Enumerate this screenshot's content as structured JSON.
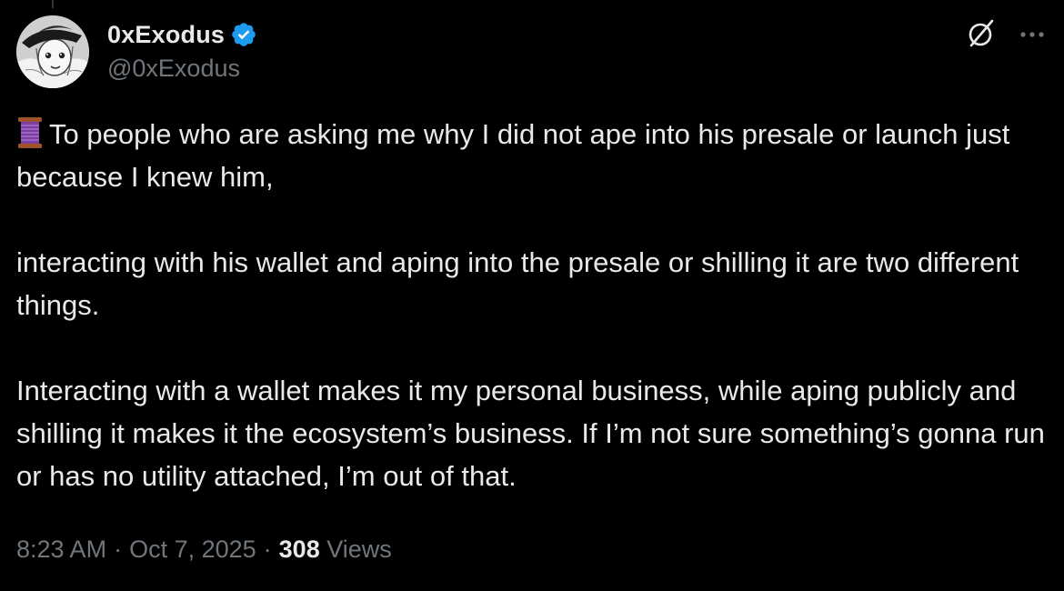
{
  "author": {
    "display_name": "0xExodus",
    "handle": "@0xExodus",
    "verified": true
  },
  "icons": {
    "verified": "verified-badge-icon",
    "grok": "grok-icon",
    "more": "more-options-icon",
    "thread": "thread-spool-emoji"
  },
  "tweet": {
    "paragraphs": [
      "To people who are asking me why I did not ape into his presale or launch just because I knew him,",
      "interacting with his wallet and aping into the presale or shilling it are two different things.",
      "Interacting with a wallet makes it my personal business, while aping publicly and shilling it makes it the ecosystem’s business. If I’m not sure something’s gonna run or has no utility attached, I’m out of that."
    ]
  },
  "meta": {
    "time": "8:23 AM",
    "separator": "·",
    "date": "Oct 7, 2025",
    "views_count": "308",
    "views_label": "Views"
  },
  "colors": {
    "background": "#000000",
    "text_primary": "#e7e9ea",
    "text_secondary": "#71767b",
    "verified_blue": "#1d9bf0"
  }
}
